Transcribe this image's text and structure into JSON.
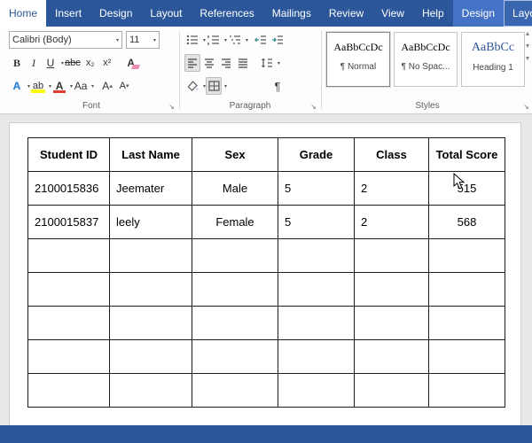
{
  "ribbon": {
    "tabs": [
      {
        "label": "Home",
        "active": true
      },
      {
        "label": "Insert"
      },
      {
        "label": "Design"
      },
      {
        "label": "Layout"
      },
      {
        "label": "References"
      },
      {
        "label": "Mailings"
      },
      {
        "label": "Review"
      },
      {
        "label": "View"
      },
      {
        "label": "Help"
      }
    ],
    "contextual_tabs": [
      {
        "label": "Design"
      },
      {
        "label": "Layout",
        "highlighted": true
      }
    ],
    "font_group": {
      "label": "Font",
      "font_name": "Calibri (Body)",
      "font_size": "11",
      "bold_label": "B",
      "italic_label": "I",
      "underline_label": "U",
      "strike_label": "abc",
      "sub_label": "x₂",
      "sup_label": "x²",
      "clear_label": "A",
      "effects_label": "A",
      "highlight_label": "ab",
      "color_label": "A",
      "case_label": "Aa",
      "grow_label": "A",
      "shrink_label": "A"
    },
    "paragraph_group": {
      "label": "Paragraph",
      "pilcrow": "¶"
    },
    "styles_group": {
      "label": "Styles",
      "styles": [
        {
          "preview": "AaBbCcDc",
          "name": "¶ Normal",
          "selected": true
        },
        {
          "preview": "AaBbCcDc",
          "name": "¶ No Spac..."
        },
        {
          "preview": "AaBbCc",
          "name": "Heading 1",
          "accent": true
        }
      ]
    }
  },
  "document": {
    "table": {
      "headers": [
        "Student ID",
        "Last Name",
        "Sex",
        "Grade",
        "Class",
        "Total Score"
      ],
      "rows": [
        [
          "2100015836",
          "Jeemater",
          "Male",
          "5",
          "2",
          "515"
        ],
        [
          "2100015837",
          "leely",
          "Female",
          "5",
          "2",
          "568"
        ],
        [
          "",
          "",
          "",
          "",
          "",
          ""
        ],
        [
          "",
          "",
          "",
          "",
          "",
          ""
        ],
        [
          "",
          "",
          "",
          "",
          "",
          ""
        ],
        [
          "",
          "",
          "",
          "",
          "",
          ""
        ],
        [
          "",
          "",
          "",
          "",
          "",
          ""
        ]
      ]
    }
  },
  "colors": {
    "ribbon_blue": "#2b579a",
    "contextual_blue": "#4472c4",
    "heading_blue": "#2f5496",
    "highlight_yellow": "#ffff00",
    "font_color_red": "#e03c31"
  }
}
